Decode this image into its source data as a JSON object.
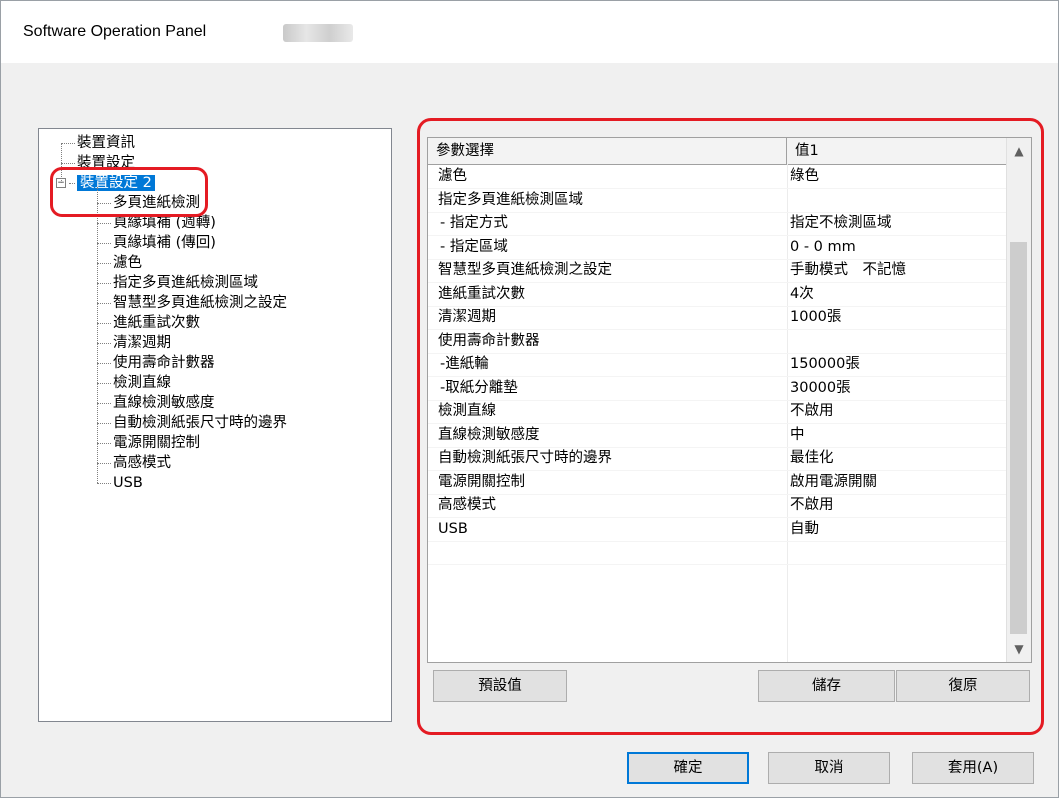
{
  "window": {
    "title": "Software Operation Panel"
  },
  "tree": {
    "items": [
      {
        "label": "裝置資訊"
      },
      {
        "label": "裝置設定"
      },
      {
        "label": "裝置設定 2",
        "selected": true,
        "expander": "−"
      },
      {
        "label": "多頁進紙檢測"
      },
      {
        "label": "頁緣填補 (週轉)"
      },
      {
        "label": "頁緣填補 (傳回)"
      },
      {
        "label": "濾色"
      },
      {
        "label": "指定多頁進紙檢測區域"
      },
      {
        "label": "智慧型多頁進紙檢測之設定"
      },
      {
        "label": "進紙重試次數"
      },
      {
        "label": "清潔週期"
      },
      {
        "label": "使用壽命計數器"
      },
      {
        "label": "檢測直線"
      },
      {
        "label": "直線檢測敏感度"
      },
      {
        "label": "自動檢測紙張尺寸時的邊界"
      },
      {
        "label": "電源開關控制"
      },
      {
        "label": "高感模式"
      },
      {
        "label": "USB"
      }
    ]
  },
  "grid": {
    "col1": "參數選擇",
    "col2": "值1",
    "rows": [
      {
        "param": "濾色",
        "value": "綠色"
      },
      {
        "param": "指定多頁進紙檢測區域",
        "value": ""
      },
      {
        "param": "- 指定方式",
        "value": "指定不檢測區域",
        "indent": true
      },
      {
        "param": "- 指定區域",
        "value": "0 - 0 mm",
        "indent": true
      },
      {
        "param": "智慧型多頁進紙檢測之設定",
        "value": "手動模式　不記憶"
      },
      {
        "param": "進紙重試次數",
        "value": "4次"
      },
      {
        "param": "清潔週期",
        "value": "1000張"
      },
      {
        "param": "使用壽命計數器",
        "value": ""
      },
      {
        "param": "-進紙輪",
        "value": "150000張",
        "indent": true
      },
      {
        "param": "-取紙分離墊",
        "value": "30000張",
        "indent": true
      },
      {
        "param": "檢測直線",
        "value": "不啟用"
      },
      {
        "param": "直線檢測敏感度",
        "value": "中"
      },
      {
        "param": "自動檢測紙張尺寸時的邊界",
        "value": "最佳化"
      },
      {
        "param": "電源開關控制",
        "value": "啟用電源開關"
      },
      {
        "param": "高感模式",
        "value": "不啟用"
      },
      {
        "param": "USB",
        "value": "自動"
      },
      {
        "param": "",
        "value": ""
      }
    ],
    "scroll_up": "▲",
    "scroll_down": "▼"
  },
  "panel_buttons": {
    "defaults": "預設值",
    "save": "儲存",
    "restore": "復原"
  },
  "dialog_buttons": {
    "ok": "確定",
    "cancel": "取消",
    "apply": "套用(A)"
  },
  "colors": {
    "highlight": "#e41b23",
    "selection": "#0078d7"
  }
}
